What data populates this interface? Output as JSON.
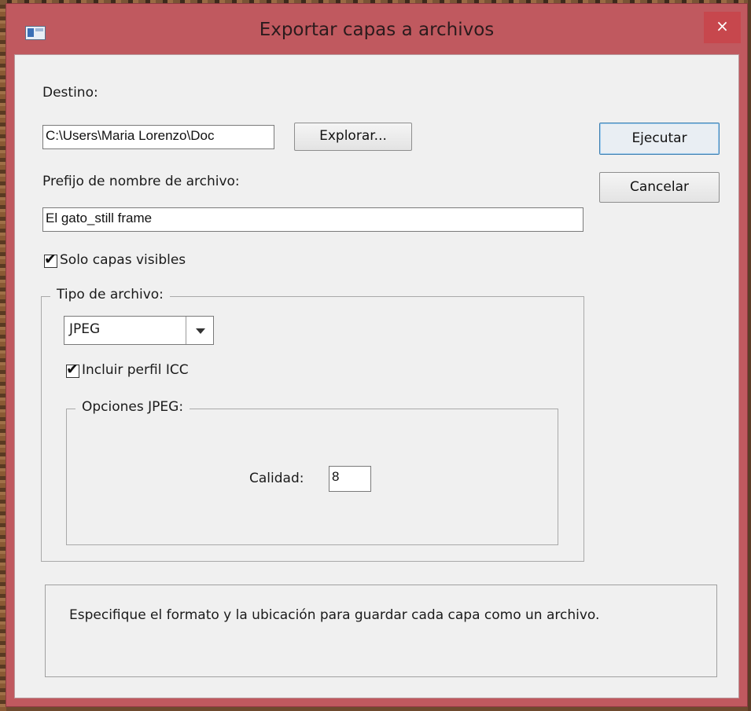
{
  "window": {
    "title": "Exportar capas a archivos",
    "close_glyph": "×",
    "icon": "app-window-icon"
  },
  "destination": {
    "label": "Destino:",
    "path_value": "C:\\Users\\Maria Lorenzo\\Doc",
    "browse_label": "Explorar..."
  },
  "actions": {
    "run_label": "Ejecutar",
    "cancel_label": "Cancelar"
  },
  "prefix": {
    "label": "Prefijo de nombre de archivo:",
    "value": "El gato_still frame"
  },
  "visible_only": {
    "label": "Solo capas visibles",
    "checked": true
  },
  "file_type": {
    "legend": "Tipo de archivo:",
    "selected": "JPEG",
    "icc_label": "Incluir perfil ICC",
    "icc_checked": true
  },
  "jpeg_options": {
    "legend": "Opciones JPEG:",
    "quality_label": "Calidad:",
    "quality_value": "8"
  },
  "info": {
    "text": "Especifique el formato y la ubicación para guardar cada capa como un archivo."
  },
  "colors": {
    "titlebar": "#c0595f",
    "close_button": "#c7474d",
    "dialog_bg": "#f0f0f0"
  }
}
